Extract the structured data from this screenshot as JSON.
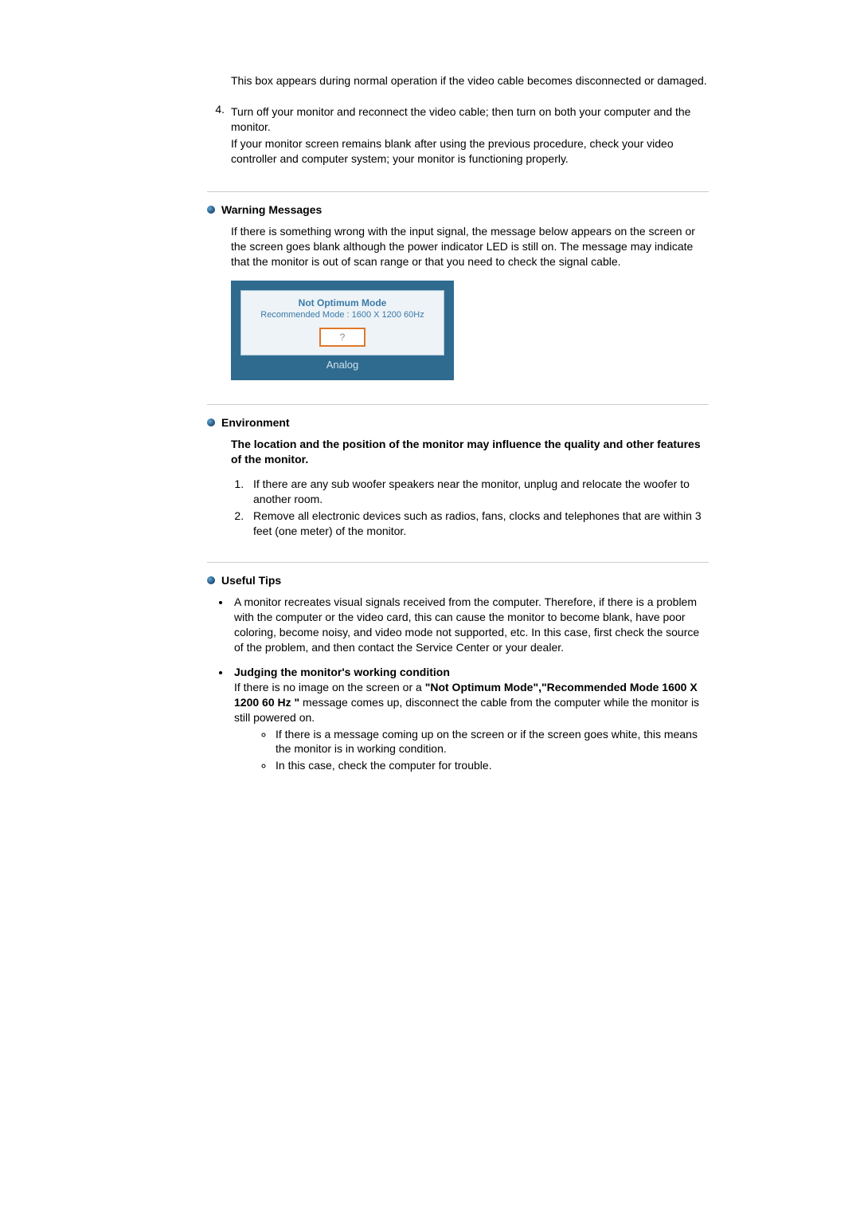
{
  "intro": {
    "box_note": "This box appears during normal operation if the video cable becomes disconnected or damaged.",
    "step4_line1": "Turn off your monitor and reconnect the video cable; then turn on both your computer and the monitor.",
    "step4_line2": "If your monitor screen remains blank after using the previous procedure, check your video controller and computer system; your monitor is functioning properly.",
    "step4_num": "4."
  },
  "warning": {
    "heading": "Warning Messages",
    "body": "If there is something wrong with the input signal, the message below appears on the screen or the screen goes blank although the power indicator LED is still on. The message may indicate that the monitor is out of scan range or that you need to check the signal cable."
  },
  "osd": {
    "line1": "Not Optimum Mode",
    "line2": "Recommended Mode : 1600 X 1200  60Hz",
    "button": "?",
    "footer": "Analog"
  },
  "environment": {
    "heading": "Environment",
    "lead": "The location and the position of the monitor may influence the quality and other features of the monitor.",
    "items": [
      "If there are any sub woofer speakers near the monitor, unplug and relocate the woofer to another room.",
      "Remove all electronic devices such as radios, fans, clocks and telephones that are within 3 feet (one meter) of the monitor."
    ]
  },
  "tips": {
    "heading": "Useful Tips",
    "bullet1": "A monitor recreates visual signals received from the computer. Therefore, if there is a problem with the computer or the video card, this can cause the monitor to become blank, have poor coloring, become noisy, and video mode not supported, etc. In this case, first check the source of the problem, and then contact the Service Center or your dealer.",
    "judge_head": "Judging the monitor's working condition",
    "judge_pre": "If there is no image on the screen or a ",
    "judge_bold": "\"Not Optimum Mode\",\"Recommended Mode 1600 X 1200 60 Hz \"",
    "judge_post": " message comes up, disconnect the cable from the computer while the monitor is still powered on.",
    "sub": [
      "If there is a message coming up on the screen or if the screen goes white, this means the monitor is in working condition.",
      "In this case, check the computer for trouble."
    ]
  }
}
